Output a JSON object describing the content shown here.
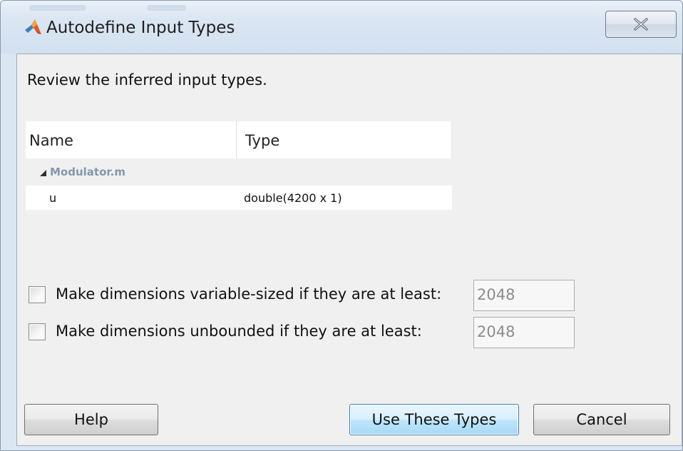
{
  "window": {
    "title": "Autodefine Input Types",
    "close_glyph": "✕"
  },
  "dialog": {
    "instruction": "Review the inferred input types.",
    "table": {
      "columns": [
        "Name",
        "Type"
      ],
      "groups": [
        {
          "label": "Modulator.m",
          "rows": [
            {
              "name": "u",
              "type": "double(4200 x 1)"
            }
          ]
        }
      ]
    },
    "options": [
      {
        "label": "Make dimensions variable-sized if they are at least:",
        "checked": false,
        "value": "2048"
      },
      {
        "label": "Make dimensions unbounded if they are at least:",
        "checked": false,
        "value": "2048"
      }
    ],
    "buttons": {
      "help": "Help",
      "use_types": "Use These Types",
      "cancel": "Cancel"
    }
  },
  "icons": {
    "app": "matlab-logo-icon",
    "close": "close-icon",
    "group_expander": "triangle-expanded-icon"
  },
  "colors": {
    "client_bg": "#f0f0f0",
    "group_label": "#8597ab",
    "default_button_border": "#3c7fb1"
  }
}
